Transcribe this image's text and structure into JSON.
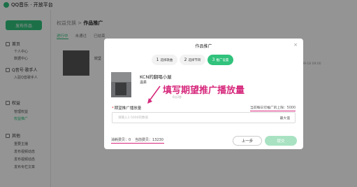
{
  "brand": "QQ音乐 · 开放平台",
  "sidebar": {
    "publish_label": "发布作品",
    "sections": [
      {
        "title": "首页",
        "items": [
          "个人中心",
          "数据中心"
        ]
      },
      {
        "title": "Q音号·歌手人",
        "items": [
          "入驻Q音歌手人"
        ]
      },
      {
        "title": "权益",
        "items": [
          "管理权益",
          "权益推广"
        ]
      },
      {
        "title": "其他",
        "items": [
          "重要主播",
          "发布视频动态",
          "发布视频动态",
          "发布专栏文章"
        ]
      }
    ]
  },
  "main": {
    "breadcrumb_parent": "权益兑换",
    "breadcrumb_sep": ">",
    "breadcrumb_current": "作品推广",
    "tabs": [
      "进行中",
      "未通过",
      "已结束"
    ],
    "row_name": "姣坚",
    "row_date": "2023-09-18 09:00"
  },
  "modal": {
    "title": "作品推广",
    "close": "×",
    "steps": [
      {
        "num": "1",
        "label": "选择歌曲"
      },
      {
        "num": "2",
        "label": "选择节目"
      },
      {
        "num": "3",
        "label": "推广设置"
      }
    ],
    "song_title": "KCN的翻唱小屋",
    "song_artist": "温柔",
    "song_meta": "6分2秒",
    "annotation": "填写期望推广播放量",
    "field_label": "期望推广播放量",
    "field_required": "*",
    "limit_text": "当前每日可推广的上限：5000",
    "input_placeholder": "请输入1-5000的数值",
    "max_label": "最大值",
    "cost_text": "消耗费贝：0",
    "balance_text": "当前费贝：13230",
    "prev_label": "上一步",
    "submit_label": "提交"
  },
  "colors": {
    "accent": "#31c27c",
    "annotation": "#d6287c"
  }
}
